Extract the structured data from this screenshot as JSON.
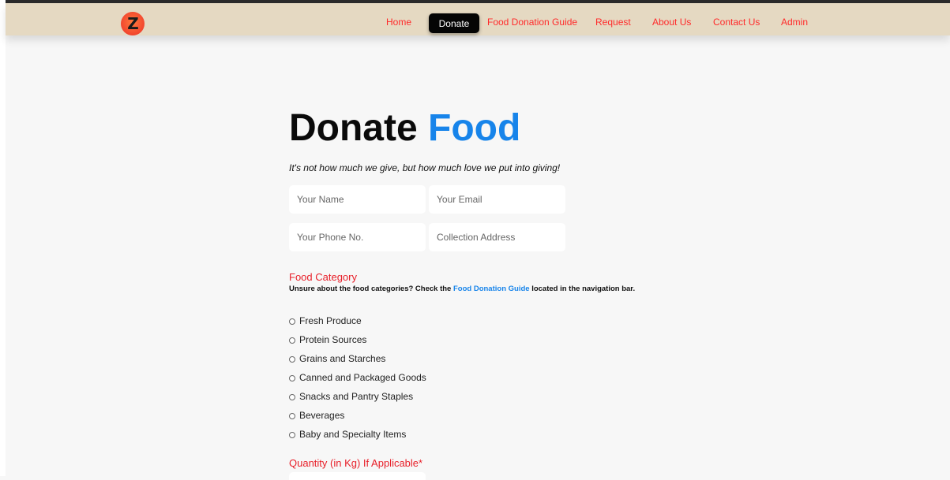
{
  "navbar": {
    "logo_letter": "Z",
    "links": [
      "Home",
      "Donate",
      "Food Donation Guide",
      "Request",
      "About Us",
      "Contact Us",
      "Admin"
    ],
    "active": "Donate"
  },
  "hero": {
    "title_main": "Donate",
    "title_accent": "Food",
    "tagline": "It's not how much we give, but how much love we put into giving!"
  },
  "form": {
    "name_placeholder": "Your Name",
    "email_placeholder": "Your Email",
    "phone_placeholder": "Your Phone No.",
    "address_placeholder": "Collection Address",
    "category_label": "Food Category",
    "category_note_pre": "Unsure about the food categories? Check the ",
    "category_note_link": "Food Donation Guide",
    "category_note_post": " located in the navigation bar.",
    "categories": [
      "Fresh Produce",
      "Protein Sources",
      "Grains and Starches",
      "Canned and Packaged Goods",
      "Snacks and Pantry Staples",
      "Beverages",
      "Baby and Specialty Items"
    ],
    "quantity_label": "Quantity (in Kg) If Applicable*"
  },
  "colors": {
    "nav_background": "#e5d9c2",
    "nav_link": "#ff2a2a",
    "accent_blue": "#1784ea",
    "label_red": "#e8202a"
  }
}
